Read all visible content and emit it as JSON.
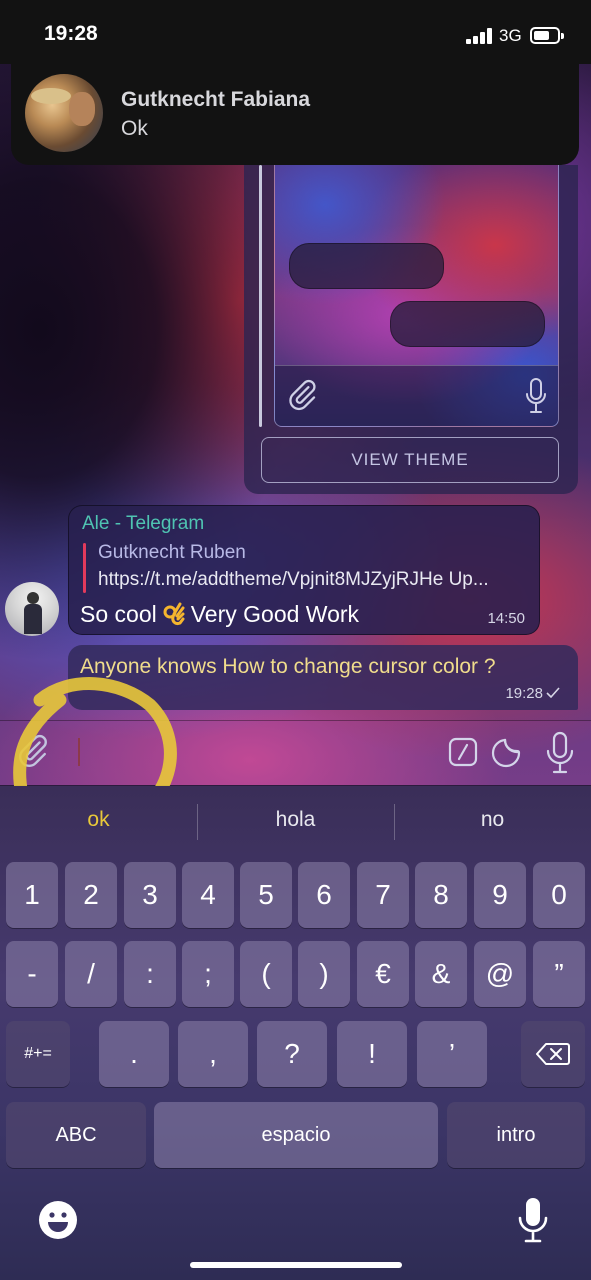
{
  "status_bar": {
    "time": "19:28",
    "network": "3G",
    "signal_icon": "cellular-signal-icon",
    "battery_icon": "battery-icon"
  },
  "notification": {
    "sender": "Gutknecht Fabiana",
    "message": "Ok"
  },
  "theme_preview": {
    "view_button": "VIEW THEME",
    "icons": [
      "paperclip-icon",
      "microphone-icon"
    ]
  },
  "incoming_message": {
    "forwarded_from": "Ale - Telegram",
    "reply_name": "Gutknecht Ruben",
    "reply_link": "https://t.me/addtheme/Vpjnit8MJZyjRJHe Up...",
    "text_before_emoji": "So cool",
    "emoji": "ok-hand-emoji",
    "text_after_emoji": "Very Good Work",
    "time": "14:50"
  },
  "outgoing_message": {
    "text": "Anyone knows How to change cursor color ?",
    "time": "19:28",
    "status_icon": "single-check-icon"
  },
  "input_bar": {
    "placeholder": "",
    "icons": [
      "paperclip-icon",
      "bot-command-icon",
      "sticker-icon",
      "microphone-icon"
    ],
    "highlight_color": "#e8c83a"
  },
  "keyboard": {
    "suggestions": [
      "ok",
      "hola",
      "no"
    ],
    "row1": [
      "1",
      "2",
      "3",
      "4",
      "5",
      "6",
      "7",
      "8",
      "9",
      "0"
    ],
    "row2": [
      "-",
      "/",
      ":",
      ";",
      "(",
      ")",
      "€",
      "&",
      "@",
      "”"
    ],
    "row3_symbols_key": "#+=",
    "row3": [
      ".",
      ",",
      "?",
      "!",
      "’"
    ],
    "abc_key": "ABC",
    "space_key": "espacio",
    "return_key": "intro",
    "icons": [
      "backspace-icon",
      "emoji-icon",
      "dictation-icon"
    ]
  },
  "colors": {
    "accent_teal": "#4fc4b2",
    "reply_bar": "#e23a5c",
    "outgoing_text": "#f0dc8c"
  }
}
